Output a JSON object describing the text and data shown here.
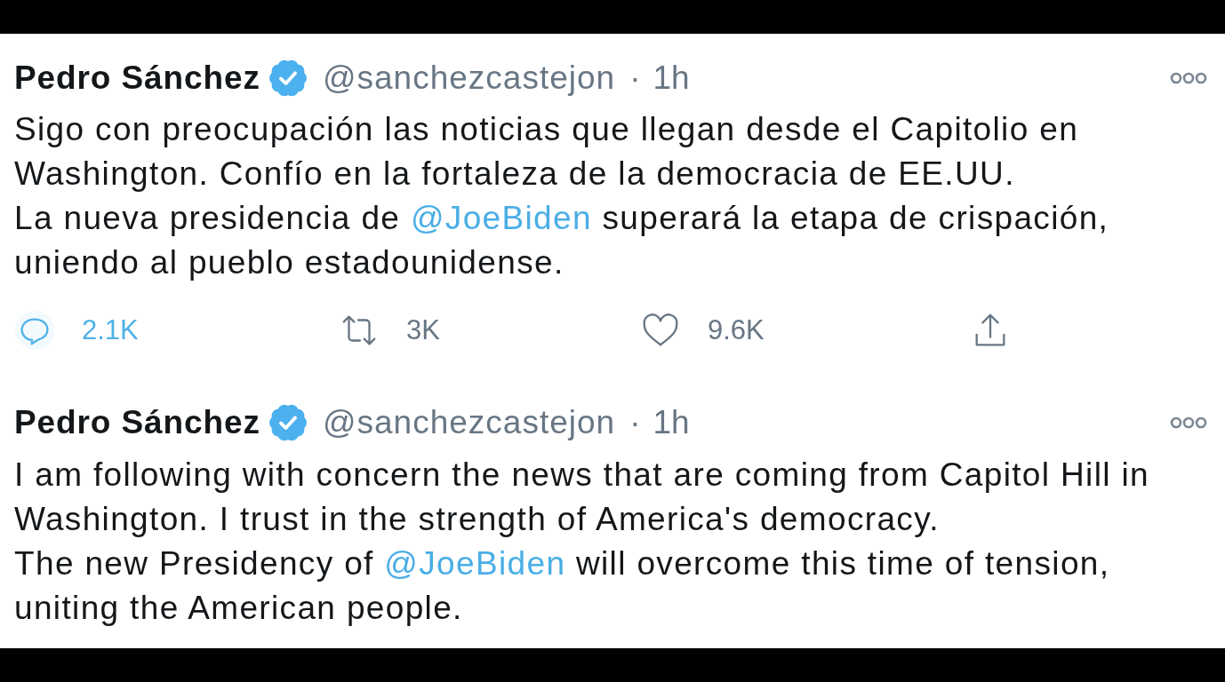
{
  "tweets": [
    {
      "author": "Pedro Sánchez",
      "verified": true,
      "handle": "@sanchezcastejon",
      "separator": "·",
      "time": "1h",
      "body": [
        [
          {
            "kind": "text",
            "text": "Sigo con preocupación las noticias que llegan desde el Capitolio en"
          }
        ],
        [
          {
            "kind": "text",
            "text": "Washington. Confío en la fortaleza de la democracia de EE.UU."
          }
        ],
        [
          {
            "kind": "text",
            "text": "La nueva presidencia de "
          },
          {
            "kind": "mention",
            "text": "@JoeBiden"
          },
          {
            "kind": "text",
            "text": " superará la etapa de crispación,"
          }
        ],
        [
          {
            "kind": "text",
            "text": "uniendo al pueblo estadounidense."
          }
        ]
      ],
      "actions": [
        {
          "kind": "reply",
          "count": "2.1K",
          "highlighted": true
        },
        {
          "kind": "retweet",
          "count": "3K",
          "highlighted": false
        },
        {
          "kind": "like",
          "count": "9.6K",
          "highlighted": false
        },
        {
          "kind": "share",
          "highlighted": false
        }
      ]
    },
    {
      "author": "Pedro Sánchez",
      "verified": true,
      "handle": "@sanchezcastejon",
      "separator": "·",
      "time": "1h",
      "body": [
        [
          {
            "kind": "text",
            "text": "I am following with concern the news that are coming from Capitol Hill in"
          }
        ],
        [
          {
            "kind": "text",
            "text": "Washington. I trust in the strength of America's democracy."
          }
        ],
        [
          {
            "kind": "text",
            "text": "The new Presidency of "
          },
          {
            "kind": "mention",
            "text": "@JoeBiden"
          },
          {
            "kind": "text",
            "text": " will overcome this time of tension,"
          }
        ],
        [
          {
            "kind": "text",
            "text": "uniting the American people."
          }
        ]
      ]
    }
  ]
}
